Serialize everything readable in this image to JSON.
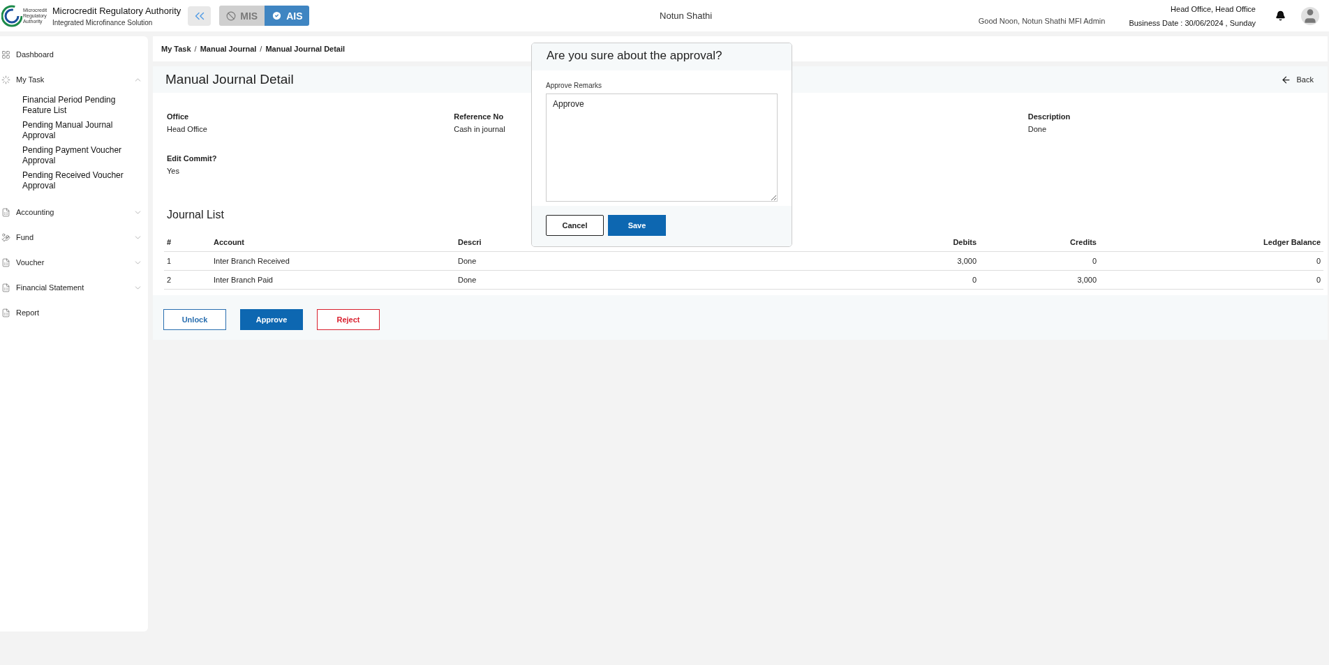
{
  "header": {
    "org_name": "Microcredit Regulatory Authority",
    "org_subtitle": "Integrated Microfinance Solution",
    "logo_text": "Microcredit Regulatory Authority",
    "modules": [
      {
        "label": "MIS",
        "selected": false
      },
      {
        "label": "AIS",
        "selected": true
      }
    ],
    "app_name": "Notun Shathi",
    "greeting": "Good Noon, Notun Shathi MFI Admin",
    "office": "Head Office, Head Office",
    "business_date": "Business Date : 30/06/2024 , Sunday"
  },
  "sidebar": {
    "items": [
      {
        "label": "Dashboard",
        "kind": "link"
      },
      {
        "label": "My Task",
        "kind": "group",
        "expanded": true,
        "children": [
          {
            "label": "Financial Period Pending Feature List"
          },
          {
            "label": "Pending Manual Journal Approval"
          },
          {
            "label": "Pending Payment Voucher Approval"
          },
          {
            "label": "Pending Received Voucher Approval"
          }
        ]
      },
      {
        "label": "Accounting",
        "kind": "group",
        "expanded": false
      },
      {
        "label": "Fund",
        "kind": "group",
        "expanded": false
      },
      {
        "label": "Voucher",
        "kind": "group",
        "expanded": false
      },
      {
        "label": "Financial Statement",
        "kind": "group",
        "expanded": false
      },
      {
        "label": "Report",
        "kind": "link"
      }
    ]
  },
  "breadcrumb": {
    "separator": "/",
    "items": [
      "My Task",
      "Manual Journal",
      "Manual Journal Detail"
    ]
  },
  "page": {
    "title": "Manual Journal Detail",
    "back": "Back",
    "fields": [
      {
        "label": "Office",
        "value": "Head Office"
      },
      {
        "label": "Reference No",
        "value": "Cash in journal"
      },
      {
        "label": "Description",
        "value": "Done"
      },
      {
        "label": "Edit Commit?",
        "value": "Yes"
      }
    ],
    "journal_title": "Journal List",
    "table": {
      "columns": [
        "#",
        "Account",
        "Descri",
        "Debits",
        "Credits",
        "Ledger Balance"
      ],
      "rows": [
        [
          "1",
          "Inter Branch Received",
          "Done",
          "3,000",
          "0",
          "0"
        ],
        [
          "2",
          "Inter Branch Paid",
          "Done",
          "0",
          "3,000",
          "0"
        ]
      ]
    },
    "actions": [
      {
        "label": "Unlock",
        "kind": "outline"
      },
      {
        "label": "Approve",
        "kind": "primary"
      },
      {
        "label": "Reject",
        "kind": "danger"
      }
    ]
  },
  "dialog": {
    "title": "Are you sure about the approval?",
    "field_label": "Approve Remarks",
    "value": "Approve",
    "buttons": [
      {
        "label": "Cancel",
        "kind": "outline"
      },
      {
        "label": "Save",
        "kind": "primary"
      }
    ]
  }
}
